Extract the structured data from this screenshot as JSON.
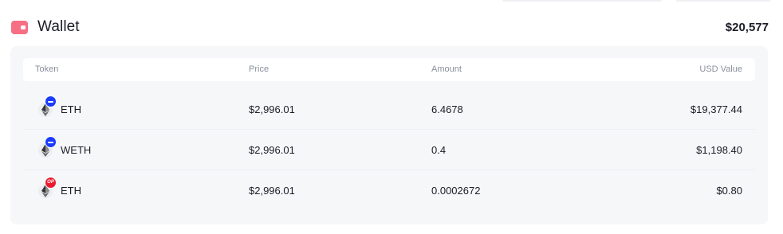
{
  "wallet": {
    "title": "Wallet",
    "total": "$20,577",
    "icon": "wallet-icon",
    "accent": "#f66f85"
  },
  "table": {
    "columns": {
      "token": "Token",
      "price": "Price",
      "amount": "Amount",
      "usd_value": "USD Value"
    },
    "rows": [
      {
        "token": "ETH",
        "price": "$2,996.01",
        "amount": "6.4678",
        "usd_value": "$19,377.44",
        "chain_badge": "blue",
        "chain_badge_text": ""
      },
      {
        "token": "WETH",
        "price": "$2,996.01",
        "amount": "0.4",
        "usd_value": "$1,198.40",
        "chain_badge": "blue",
        "chain_badge_text": ""
      },
      {
        "token": "ETH",
        "price": "$2,996.01",
        "amount": "0.0002672",
        "usd_value": "$0.80",
        "chain_badge": "red",
        "chain_badge_text": "OP"
      }
    ]
  },
  "colors": {
    "chain_blue": "#1a3cff",
    "chain_red": "#ea1b2f",
    "card_bg": "#f6f7f9"
  }
}
